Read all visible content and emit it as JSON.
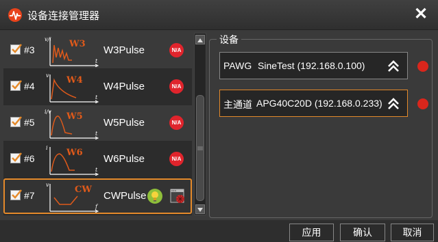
{
  "window": {
    "title": "设备连接管理器"
  },
  "channels": [
    {
      "number": "#3",
      "name": "W3Pulse",
      "wave_label": "W3",
      "axis_y": "v/i",
      "axis_x": "t",
      "status": "N/A",
      "checked": true
    },
    {
      "number": "#4",
      "name": "W4Pulse",
      "wave_label": "W4",
      "axis_y": "v",
      "axis_x": "t",
      "status": "N/A",
      "checked": true
    },
    {
      "number": "#5",
      "name": "W5Pulse",
      "wave_label": "W5",
      "axis_y": "i/v",
      "axis_x": "t",
      "status": "N/A",
      "checked": true
    },
    {
      "number": "#6",
      "name": "W6Pulse",
      "wave_label": "W6",
      "axis_y": "i",
      "axis_x": "t",
      "status": "N/A",
      "checked": true
    },
    {
      "number": "#7",
      "name": "CWPulse",
      "wave_label": "CW",
      "axis_y": "v",
      "axis_x": "f",
      "status": "connected",
      "checked": true
    }
  ],
  "devices_group": {
    "label": "设备",
    "devices": [
      {
        "type": "PAWG",
        "name": "SineTest (192.168.0.100)",
        "status_color": "#d9261c"
      },
      {
        "type": "主通道",
        "name": "APG40C20D (192.168.0.233)",
        "status_color": "#d9261c"
      }
    ]
  },
  "buttons": {
    "apply": "应用",
    "ok": "确认",
    "cancel": "取消"
  },
  "colors": {
    "accent": "#e58a2a",
    "waveform": "#e05a1a",
    "na_badge": "#e0242c"
  }
}
